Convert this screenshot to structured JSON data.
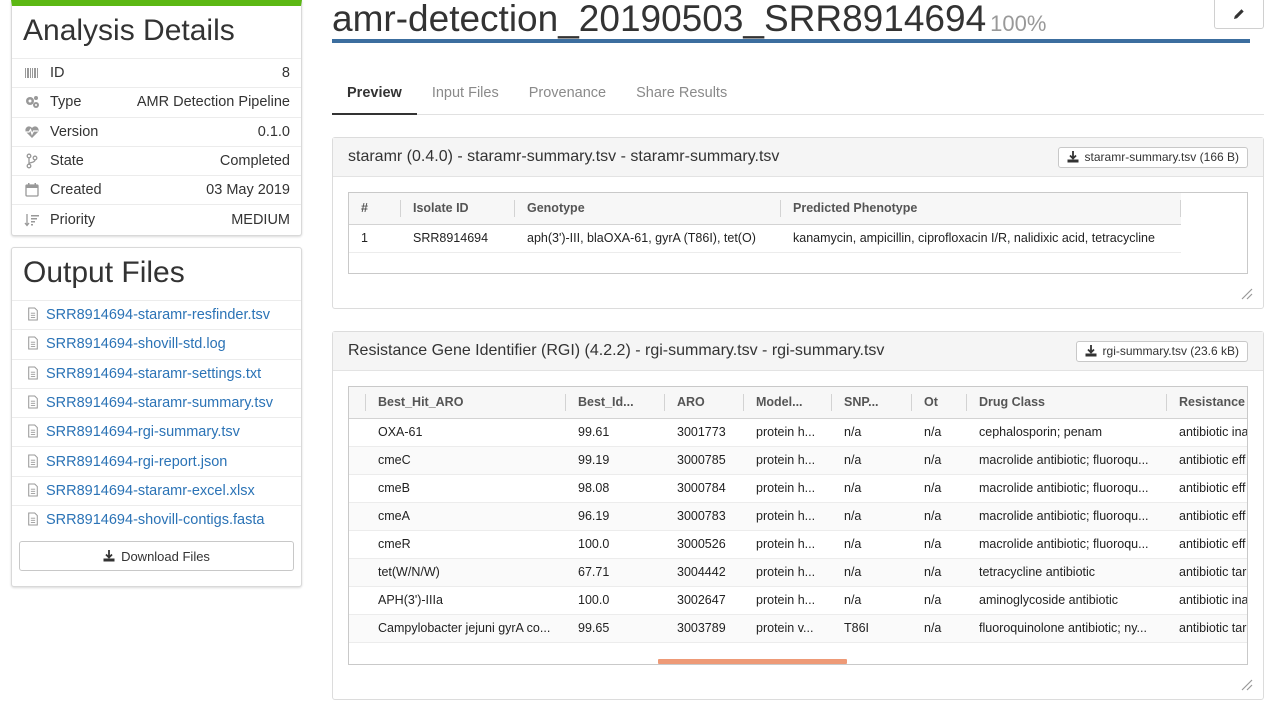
{
  "details": {
    "heading": "Analysis Details",
    "rows": [
      {
        "label": "ID",
        "value": "8",
        "icon": "barcode-icon"
      },
      {
        "label": "Type",
        "value": "AMR Detection Pipeline",
        "icon": "gears-icon"
      },
      {
        "label": "Version",
        "value": "0.1.0",
        "icon": "heartbeat-icon"
      },
      {
        "label": "State",
        "value": "Completed",
        "icon": "branch-icon"
      },
      {
        "label": "Created",
        "value": "03 May 2019",
        "icon": "calendar-icon"
      },
      {
        "label": "Priority",
        "value": "MEDIUM",
        "icon": "sort-amount-icon"
      }
    ]
  },
  "output_files": {
    "heading": "Output Files",
    "files": [
      "SRR8914694-staramr-resfinder.tsv",
      "SRR8914694-shovill-std.log",
      "SRR8914694-staramr-settings.txt",
      "SRR8914694-staramr-summary.tsv",
      "SRR8914694-rgi-summary.tsv",
      "SRR8914694-rgi-report.json",
      "SRR8914694-staramr-excel.xlsx",
      "SRR8914694-shovill-contigs.fasta"
    ],
    "download_label": "Download Files"
  },
  "title": {
    "name": "amr-detection_20190503_SRR8914694",
    "progress": "100%"
  },
  "tabs": [
    "Preview",
    "Input Files",
    "Provenance",
    "Share Results"
  ],
  "staramr_card": {
    "title": "staramr (0.4.0) - staramr-summary.tsv - staramr-summary.tsv",
    "download_label": "staramr-summary.tsv (166 B)",
    "columns": [
      "#",
      "Isolate ID",
      "Genotype",
      "Predicted Phenotype"
    ],
    "rows": [
      [
        "1",
        "SRR8914694",
        "aph(3')-III, blaOXA-61, gyrA (T86I), tet(O)",
        "kanamycin, ampicillin, ciprofloxacin I/R, nalidixic acid, tetracycline"
      ]
    ]
  },
  "rgi_card": {
    "title": "Resistance Gene Identifier (RGI) (4.2.2) - rgi-summary.tsv - rgi-summary.tsv",
    "download_label": "rgi-summary.tsv (23.6 kB)",
    "columns": [
      "Best_Hit_ARO",
      "Best_Id...",
      "ARO",
      "Model...",
      "SNP...",
      "Ot",
      "Drug Class",
      "Resistance M"
    ],
    "rows": [
      [
        "OXA-61",
        "99.61",
        "3001773",
        "protein h...",
        "n/a",
        "n/a",
        "cephalosporin; penam",
        "antibiotic ina"
      ],
      [
        "cmeC",
        "99.19",
        "3000785",
        "protein h...",
        "n/a",
        "n/a",
        "macrolide antibiotic; fluoroqu...",
        "antibiotic eff"
      ],
      [
        "cmeB",
        "98.08",
        "3000784",
        "protein h...",
        "n/a",
        "n/a",
        "macrolide antibiotic; fluoroqu...",
        "antibiotic eff"
      ],
      [
        "cmeA",
        "96.19",
        "3000783",
        "protein h...",
        "n/a",
        "n/a",
        "macrolide antibiotic; fluoroqu...",
        "antibiotic eff"
      ],
      [
        "cmeR",
        "100.0",
        "3000526",
        "protein h...",
        "n/a",
        "n/a",
        "macrolide antibiotic; fluoroqu...",
        "antibiotic eff"
      ],
      [
        "tet(W/N/W)",
        "67.71",
        "3004442",
        "protein h...",
        "n/a",
        "n/a",
        "tetracycline antibiotic",
        "antibiotic tar"
      ],
      [
        "APH(3')-IIIa",
        "100.0",
        "3002647",
        "protein h...",
        "n/a",
        "n/a",
        "aminoglycoside antibiotic",
        "antibiotic ina"
      ],
      [
        "Campylobacter jejuni gyrA co...",
        "99.65",
        "3003789",
        "protein v...",
        "T86I",
        "n/a",
        "fluoroquinolone antibiotic; ny...",
        "antibiotic tar"
      ]
    ]
  },
  "colors": {
    "accent_green": "#5cb814",
    "title_underline": "#3c6e9f",
    "link": "#2b73b6",
    "scrollbar": "#ee9a77"
  }
}
